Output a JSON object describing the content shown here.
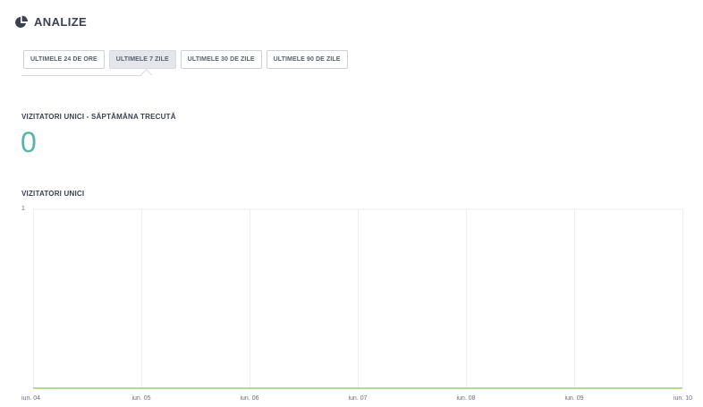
{
  "header": {
    "title": "ANALIZE",
    "icon": "pie-chart-icon"
  },
  "range_tabs": [
    {
      "label": "ULTIMELE 24 DE ORE",
      "active": false
    },
    {
      "label": "ULTIMELE 7 ZILE",
      "active": true
    },
    {
      "label": "ULTIMELE 30 DE ZILE",
      "active": false
    },
    {
      "label": "ULTIMELE 90 DE ZILE",
      "active": false
    }
  ],
  "summary": {
    "label": "VIZITATORI UNICI - SĂPTĂMÂNA TRECUTĂ",
    "value": "0"
  },
  "chart_section": {
    "label": "VIZITATORI UNICI"
  },
  "colors": {
    "accent_value": "#57b3a6",
    "series_line": "#9ccf6a",
    "gridline": "#eceef0"
  },
  "chart_data": {
    "type": "line",
    "categories": [
      "iun. 04",
      "iun. 05",
      "iun. 06",
      "iun. 07",
      "iun. 08",
      "iun. 09",
      "iun. 10"
    ],
    "series": [
      {
        "values": [
          0,
          0,
          0,
          0,
          0,
          0,
          0
        ]
      }
    ],
    "ylim": [
      0,
      1
    ],
    "y_ticks": [
      "1"
    ],
    "grid": true
  }
}
